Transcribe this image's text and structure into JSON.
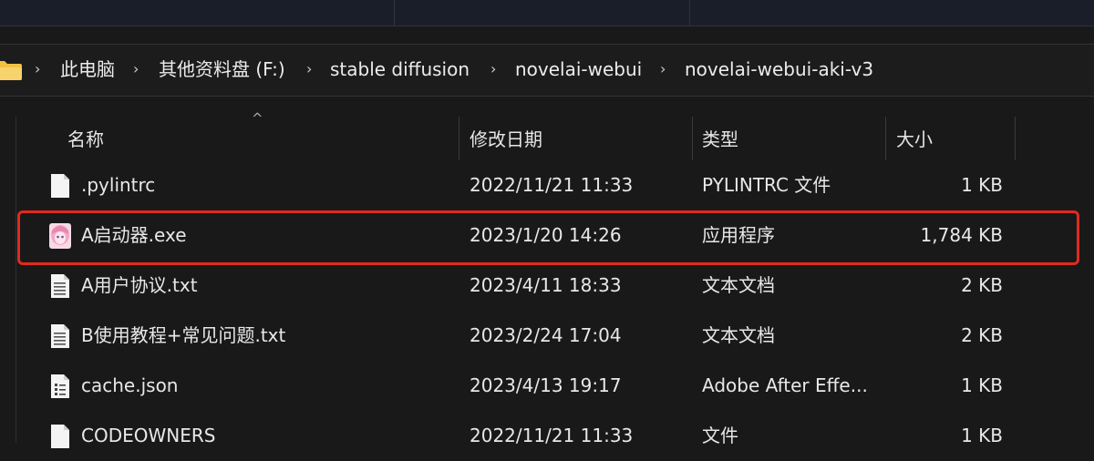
{
  "breadcrumb": {
    "items": [
      "此电脑",
      "其他资料盘 (F:)",
      "stable diffusion",
      "novelai-webui",
      "novelai-webui-aki-v3"
    ],
    "chevron": "›"
  },
  "columns": {
    "name": "名称",
    "modified": "修改日期",
    "type": "类型",
    "size": "大小",
    "sort_indicator": "^"
  },
  "files": [
    {
      "name": ".pylintrc",
      "modified": "2022/11/21 11:33",
      "type": "PYLINTRC 文件",
      "size": "1 KB",
      "icon": "blank-file-icon"
    },
    {
      "name": "A启动器.exe",
      "modified": "2023/1/20 14:26",
      "type": "应用程序",
      "size": "1,784 KB",
      "icon": "app-avatar-icon"
    },
    {
      "name": "A用户协议.txt",
      "modified": "2023/4/11 18:33",
      "type": "文本文档",
      "size": "2 KB",
      "icon": "text-file-icon"
    },
    {
      "name": "B使用教程+常见问题.txt",
      "modified": "2023/2/24 17:04",
      "type": "文本文档",
      "size": "2 KB",
      "icon": "text-file-icon"
    },
    {
      "name": "cache.json",
      "modified": "2023/4/13 19:17",
      "type": "Adobe After Effe...",
      "size": "1 KB",
      "icon": "json-file-icon"
    },
    {
      "name": "CODEOWNERS",
      "modified": "2022/11/21 11:33",
      "type": "文件",
      "size": "1 KB",
      "icon": "blank-file-icon"
    }
  ],
  "highlight_color": "#e02a1f",
  "folder_color": "#f3c244"
}
